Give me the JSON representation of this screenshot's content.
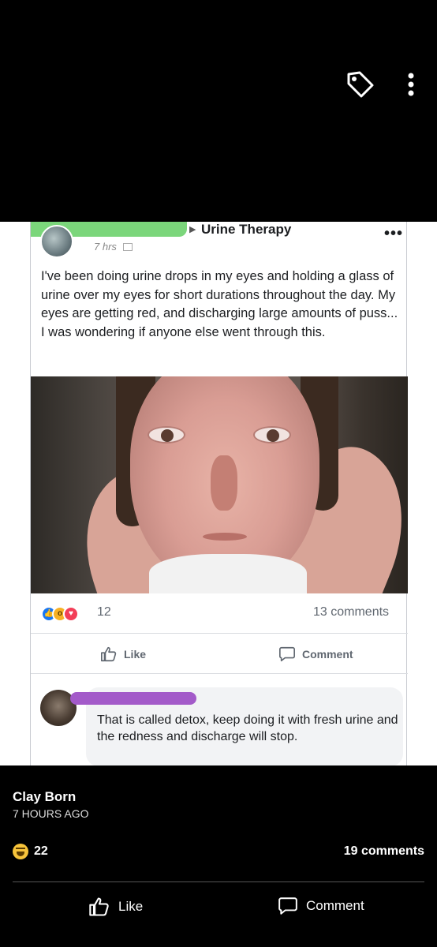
{
  "screenshot": {
    "group_name": "Urine Therapy",
    "post_time": "7 hrs",
    "post_text": "I've been doing urine drops in my eyes and holding a glass of urine over my eyes for short durations throughout the day. My eyes are getting red, and discharging large amounts of puss... I was wondering if anyone else went through this.",
    "reaction_count": "12",
    "comments_count": "13 comments",
    "like_label": "Like",
    "comment_label": "Comment",
    "reply_text": "That is called detox, keep doing it with fresh urine and the redness and discharge will stop."
  },
  "post": {
    "author": "Clay Born",
    "time": "7 HOURS AGO",
    "reaction_count": "22",
    "comments_count": "19 comments",
    "like_label": "Like",
    "comment_label": "Comment"
  },
  "icons": {
    "top_right": [
      "tag-icon",
      "more-vertical-icon"
    ],
    "reactions": [
      "like-icon",
      "wow-icon",
      "love-icon",
      "haha-icon"
    ]
  },
  "colors": {
    "background": "#000000",
    "facebook_blue": "#1877f2",
    "redaction_green": "#7bd67b",
    "redaction_purple": "#a35ac9"
  }
}
